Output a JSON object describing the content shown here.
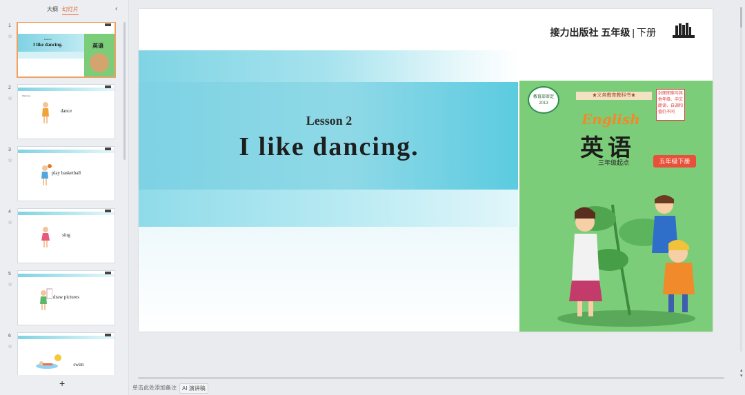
{
  "sidebar": {
    "tabs": {
      "outline": "大纲",
      "slides": "幻灯片"
    },
    "collapse_icon": "‹",
    "add_icon": "+",
    "slides": [
      {
        "num": "1",
        "lesson": "Lesson 2",
        "title": "I like dancing.",
        "cover": "英语"
      },
      {
        "num": "2",
        "label": "dance",
        "tag": "Warming"
      },
      {
        "num": "3",
        "label": "play basketball"
      },
      {
        "num": "4",
        "label": "sing"
      },
      {
        "num": "5",
        "label": "draw pictures"
      },
      {
        "num": "6",
        "label": "swim"
      }
    ]
  },
  "slide": {
    "publisher": "接力出版社 五年级",
    "separator": "|",
    "volume": "下册",
    "lesson": "Lesson 2",
    "title": "I like dancing.",
    "cover": {
      "badge": "教育部审定 2013",
      "series": "★义务教育教科书★",
      "english": "English",
      "subject": "英语",
      "start": "三年级起点",
      "grade": "五年级下册",
      "note": "封面图案与其他年级、中文朗读、自调和值仍不同"
    }
  },
  "footer": {
    "notes_placeholder": "单击此处添加备注",
    "ai_label": "AI 演讲稿"
  },
  "colors": {
    "accent": "#e0622b",
    "cyan": "#5ccbe0",
    "cover_green": "#7ccd7a"
  }
}
